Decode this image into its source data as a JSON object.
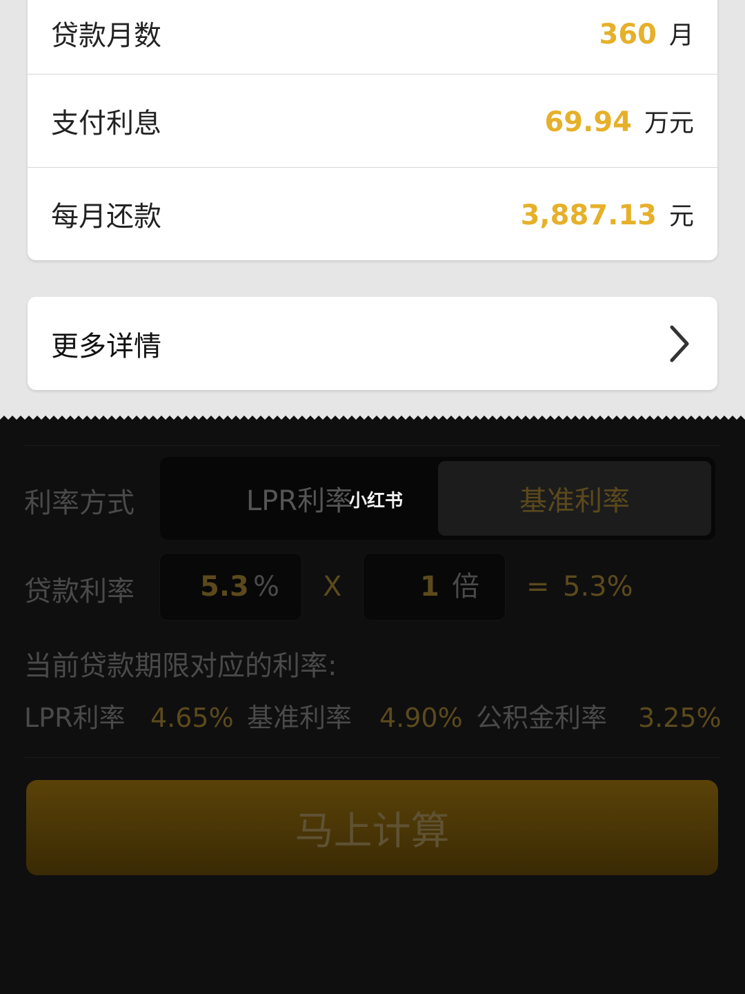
{
  "results": {
    "rows": [
      {
        "label": "贷款月数",
        "value": "360",
        "unit": "月"
      },
      {
        "label": "支付利息",
        "value": "69.94",
        "unit": "万元"
      },
      {
        "label": "每月还款",
        "value": "3,887.13",
        "unit": "元"
      }
    ]
  },
  "more_details": {
    "label": "更多详情",
    "icon": "chevron-right-icon"
  },
  "rate_mode": {
    "label": "利率方式",
    "options": [
      "LPR利率",
      "基准利率"
    ],
    "selected": "基准利率"
  },
  "watermark": "小红书",
  "loan_rate": {
    "label": "贷款利率",
    "base_value": "5.3",
    "base_unit": "%",
    "times_symbol": "X",
    "multiplier_value": "1",
    "multiplier_unit": "倍",
    "equals_symbol": "=",
    "result": "5.3%"
  },
  "current_rates": {
    "title": "当前贷款期限对应的利率:",
    "items": [
      {
        "name": "LPR利率",
        "value": "4.65%"
      },
      {
        "name": "基准利率",
        "value": "4.90%"
      },
      {
        "name": "公积金利率",
        "value": "3.25%"
      }
    ]
  },
  "calculate_button": {
    "label": "马上计算"
  },
  "colors": {
    "accent": "#e6b02a",
    "sheet_bg": "#0f0f0f",
    "button": "#4a3606"
  }
}
